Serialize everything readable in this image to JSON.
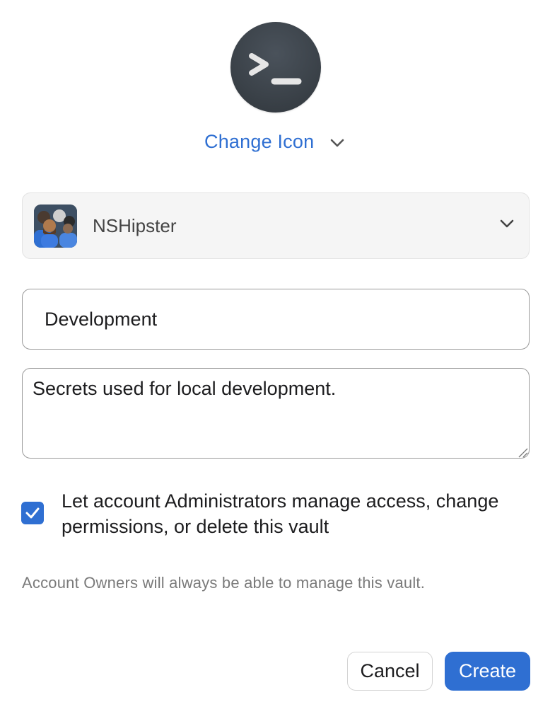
{
  "vault_icon": {
    "icon": "terminal-prompt-icon",
    "background": "#3b4249"
  },
  "change_icon": {
    "label": "Change Icon",
    "icon": "chevron-down-icon",
    "color": "#2f6fd2"
  },
  "account": {
    "name": "NSHipster",
    "avatar": "group-avatar",
    "icon": "chevron-down-icon"
  },
  "form": {
    "name_value": "Development",
    "description_value": "Secrets used for local development."
  },
  "admin_permission": {
    "checked": true,
    "label": "Let account Administrators manage access, change permissions, or delete this vault"
  },
  "note": "Account Owners will always be able to manage this vault.",
  "buttons": {
    "cancel": "Cancel",
    "create": "Create"
  },
  "colors": {
    "accent": "#2f6fd2"
  }
}
